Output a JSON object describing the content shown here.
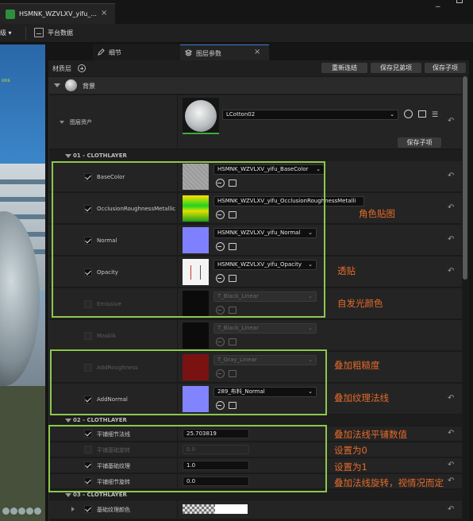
{
  "doc_tab": {
    "title": "HSMNK_WZVLXV_yifu_..."
  },
  "toolbar": {
    "left_label": "级 ▾",
    "platform_data": "平台数据"
  },
  "viewport": {
    "overlay_text": "ons"
  },
  "panel_tabs": [
    {
      "label": "细节"
    },
    {
      "label": "图层参数"
    }
  ],
  "layers_bar": {
    "label": "材质层",
    "buttons": [
      "重新连结",
      "保存兄弟项",
      "保存子项"
    ]
  },
  "background": {
    "label": "背景",
    "asset_label": "图层资产",
    "asset_value": "LCotton02",
    "save_child": "保存子项"
  },
  "sections": {
    "cloth1": "01 - CLOTHLAYER",
    "cloth2": "02 - CLOTHLAYER",
    "cloth3": "03 - CLOTHLAYER"
  },
  "params": [
    {
      "name": "BaseColor",
      "checked": true,
      "enabled": true,
      "value": "HSMNK_WZVLXV_yifu_BaseColor"
    },
    {
      "name": "OcclusionRoughnessMetallic",
      "checked": true,
      "enabled": true,
      "value": "HSMNK_WZVLXV_yifu_OcclusionRoughnessMetalli"
    },
    {
      "name": "Normal",
      "checked": true,
      "enabled": true,
      "value": "HSMNK_WZVLXV_yifu_Normal"
    },
    {
      "name": "Opacity",
      "checked": true,
      "enabled": true,
      "value": "HSMNK_WZVLXV_yifu_Opacity"
    },
    {
      "name": "Emissive",
      "checked": false,
      "enabled": false,
      "value": "T_Black_Linear"
    },
    {
      "name": "Masklk",
      "checked": false,
      "enabled": false,
      "value": "T_Black_Linear"
    },
    {
      "name": "AddRoughness",
      "checked": false,
      "enabled": false,
      "value": "T_Gray_Linear"
    },
    {
      "name": "AddNormal",
      "checked": true,
      "enabled": true,
      "value": "289_布料_Normal"
    }
  ],
  "scalars": [
    {
      "name": "平铺细节法线",
      "checked": true,
      "enabled": true,
      "value": "25.703819"
    },
    {
      "name": "平铺基础旋转",
      "checked": false,
      "enabled": false,
      "value": "0.0"
    },
    {
      "name": "平铺基础纹理",
      "checked": true,
      "enabled": true,
      "value": "1.0"
    },
    {
      "name": "平铺细节旋转",
      "checked": true,
      "enabled": true,
      "value": "0.0"
    }
  ],
  "base_color_param": {
    "name": "基础纹理颜色"
  },
  "annotations": {
    "a1": "角色贴图",
    "a2": "透贴",
    "a3": "自发光颜色",
    "a4": "叠加粗糙度",
    "a5": "叠加纹理法线",
    "a6": "叠加法线平铺数值",
    "a7": "设置为0",
    "a8": "设置为1",
    "a9": "叠加法线旋转，视情况而定"
  },
  "colors": {
    "highlight": "#8cc84b",
    "annotation": "#e56a2a"
  }
}
